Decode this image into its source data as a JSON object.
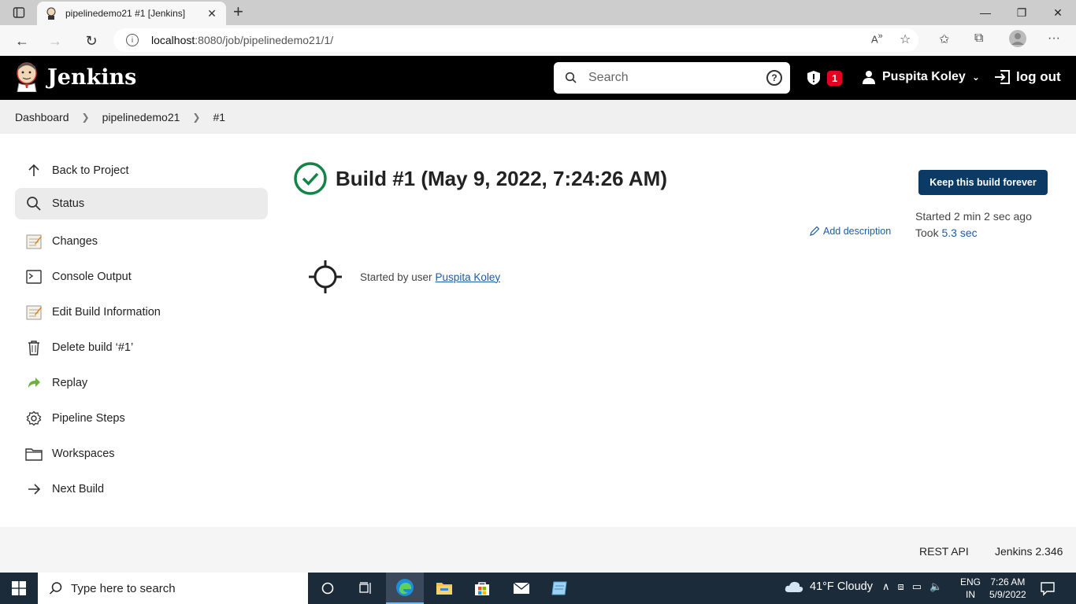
{
  "browser": {
    "tab_title": "pipelinedemo21 #1 [Jenkins]",
    "tab_close": "✕",
    "new_tab": "+",
    "url_host": "localhost",
    "url_path": ":8080/job/pipelinedemo21/1/"
  },
  "header": {
    "app_name": "Jenkins",
    "search_placeholder": "Search",
    "help": "?",
    "security_count": "1",
    "user_name": "Puspita Koley",
    "logout_label": "log out"
  },
  "breadcrumb": [
    "Dashboard",
    "pipelinedemo21",
    "#1"
  ],
  "sidebar": {
    "items": [
      {
        "label": "Back to Project",
        "icon": "arrow-up-icon"
      },
      {
        "label": "Status",
        "icon": "search-icon"
      },
      {
        "label": "Changes",
        "icon": "notepad-icon"
      },
      {
        "label": "Console Output",
        "icon": "terminal-icon"
      },
      {
        "label": "Edit Build Information",
        "icon": "notepad-icon"
      },
      {
        "label": "Delete build ‘#1’",
        "icon": "trash-icon"
      },
      {
        "label": "Replay",
        "icon": "replay-icon"
      },
      {
        "label": "Pipeline Steps",
        "icon": "gear-icon"
      },
      {
        "label": "Workspaces",
        "icon": "folder-icon"
      },
      {
        "label": "Next Build",
        "icon": "arrow-right-icon"
      }
    ]
  },
  "build": {
    "title": "Build #1 (May 9, 2022, 7:24:26 AM)",
    "keep_button": "Keep this build forever",
    "started": "Started 2 min 2 sec ago",
    "took_prefix": "Took ",
    "took_value": "5.3 sec",
    "add_description": "Add description",
    "cause_text": "Started by user",
    "cause_user": "Puspita Koley",
    "status_color": "#138347"
  },
  "footer": {
    "rest_api": "REST API",
    "version": "Jenkins 2.346"
  },
  "taskbar": {
    "search_placeholder": "Type here to search",
    "weather": "41°F  Cloudy",
    "lang_line1": "ENG",
    "lang_line2": "IN",
    "time": "7:26 AM",
    "date": "5/9/2022"
  }
}
